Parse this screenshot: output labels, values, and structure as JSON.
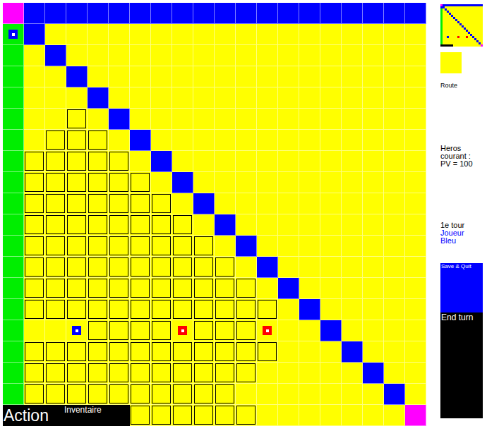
{
  "board": {
    "rows": [
      "MBBBBBBBBBBBBBBBBBBB",
      "GBYYYYYYYYYYYYYYYYYY",
      "GYBYYYYYYYYYYYYYYYYY",
      "GYYBYYYYYYYYYYYYYYYY",
      "GYYYBYYYYYYYYYYYYYYY",
      "GYYFYBYYYYYYYYYYYYYY",
      "GYFFFYBYYYYYYYYYYYYY",
      "GFFFFFYBYYYYYYYYYYYY",
      "GFFFFFFYBYYYYYYYYYYY",
      "GFFFFFFFYBYYYYYYYYYY",
      "GFFFFFFFFYBYYYYYYYYY",
      "GFFFFFFFFFYBYYYYYYYY",
      "GFFFFFFFFFFYBYYYYYYY",
      "GFFFFFFFFFFFYBYYYYYY",
      "GFFFFFFFFFFFFYBYYYYY",
      "GYYYFFFFYFFFYYYBYYYY",
      "GFFFFFFFFFFFFYYYBYYY",
      "GFFFFFFFFFFFYYYYYBYY",
      "GFFFFFFFFFFYYYYYYYBY",
      "AAAAAAFFFFFFYYYYYYYM"
    ],
    "units": [
      {
        "row": 1,
        "col": 0,
        "color": "#0000ff"
      },
      {
        "row": 15,
        "col": 3,
        "color": "#0000ff"
      },
      {
        "row": 15,
        "col": 8,
        "color": "#ff0000"
      },
      {
        "row": 15,
        "col": 12,
        "color": "#ff0000"
      }
    ]
  },
  "action_panel": {
    "title": "Action",
    "inventory": "Inventaire"
  },
  "sidebar": {
    "terrain": "Route",
    "hero": [
      "Heros",
      "courant :",
      "PV = 100"
    ],
    "turn": {
      "label": "1e tour",
      "player": "Joueur Bleu",
      "player_color": "#0000ff"
    },
    "save_button": "Save & Quit",
    "end_turn_button": "End turn"
  }
}
